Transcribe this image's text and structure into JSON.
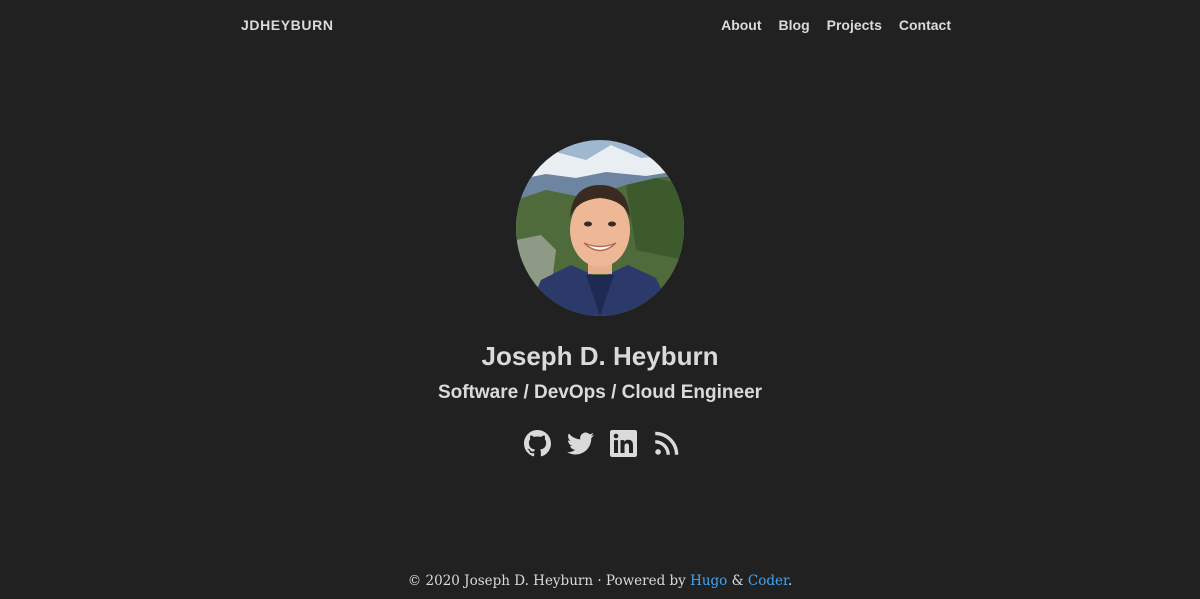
{
  "navbar": {
    "brand": "JDHEYBURN",
    "links": [
      {
        "label": "About"
      },
      {
        "label": "Blog"
      },
      {
        "label": "Projects"
      },
      {
        "label": "Contact"
      }
    ]
  },
  "profile": {
    "name": "Joseph D. Heyburn",
    "tagline": "Software / DevOps / Cloud Engineer"
  },
  "social": {
    "icons": [
      "github-icon",
      "twitter-icon",
      "linkedin-icon",
      "rss-icon"
    ]
  },
  "footer": {
    "prefix": "© 2020 Joseph D. Heyburn · Powered by ",
    "link1": "Hugo",
    "middle": " & ",
    "link2": "Coder",
    "suffix": "."
  },
  "colors": {
    "background": "#212121",
    "text": "#dadada",
    "link": "#42a5f5"
  }
}
